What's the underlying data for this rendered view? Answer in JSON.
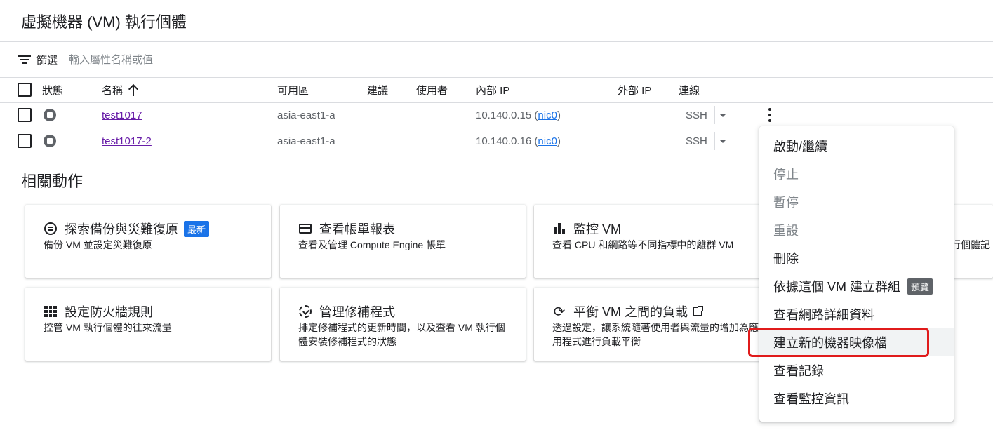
{
  "page": {
    "title": "虛擬機器 (VM) 執行個體"
  },
  "filter": {
    "label": "篩選",
    "placeholder": "輸入屬性名稱或值"
  },
  "table": {
    "headers": {
      "status": "狀態",
      "name": "名稱",
      "zone": "可用區",
      "recommendation": "建議",
      "in_use_by": "使用者",
      "internal_ip": "內部 IP",
      "external_ip": "外部 IP",
      "connect": "連線"
    },
    "rows": [
      {
        "name": "test1017",
        "zone": "asia-east1-a",
        "internal_ip": "10.140.0.15 (",
        "nic": "nic0",
        "nic_close": ")",
        "connect": "SSH",
        "status": "stopped"
      },
      {
        "name": "test1017-2",
        "zone": "asia-east1-a",
        "internal_ip": "10.140.0.16 (",
        "nic": "nic0",
        "nic_close": ")",
        "connect": "SSH",
        "status": "stopped"
      }
    ]
  },
  "related": {
    "title": "相關動作",
    "cards": [
      {
        "icon": "backup-icon",
        "title": "探索備份與災難復原",
        "badge": "最新",
        "desc": "備份 VM 並設定災難復原"
      },
      {
        "icon": "billing-icon",
        "title": "查看帳單報表",
        "desc": "查看及管理 Compute Engine 帳單"
      },
      {
        "icon": "bar-chart-icon",
        "title": "監控 VM",
        "desc": "查看 CPU 和網路等不同指標中的離群 VM"
      },
      {
        "icon": "hidden-card",
        "title": "",
        "desc": "行個體記"
      },
      {
        "icon": "firewall-icon",
        "title": "設定防火牆規則",
        "desc": "控管 VM 執行個體的往來流量"
      },
      {
        "icon": "patch-icon",
        "title": "管理修補程式",
        "desc": "排定修補程式的更新時間，以及查看 VM 執行個體安裝修補程式的狀態"
      },
      {
        "icon": "load-balance-icon",
        "title": "平衡 VM 之間的負載",
        "desc": "透過設定，讓系統隨著使用者與流量的增加為應用程式進行負載平衡"
      }
    ]
  },
  "menu": {
    "items": [
      {
        "label": "啟動/繼續",
        "enabled": true
      },
      {
        "label": "停止",
        "enabled": false
      },
      {
        "label": "暫停",
        "enabled": false
      },
      {
        "label": "重設",
        "enabled": false
      },
      {
        "label": "刪除",
        "enabled": true
      },
      {
        "label": "依據這個 VM 建立群組",
        "badge": "預覽",
        "enabled": true
      },
      {
        "label": "查看網路詳細資料",
        "enabled": true
      },
      {
        "label": "建立新的機器映像檔",
        "enabled": true,
        "highlighted": true
      },
      {
        "label": "查看記錄",
        "enabled": true
      },
      {
        "label": "查看監控資訊",
        "enabled": true
      }
    ]
  },
  "colors": {
    "link_visited": "#681da8",
    "link": "#1a73e8",
    "badge_new": "#1a73e8",
    "badge_preview": "#5f6368",
    "highlight_outline": "#e01b1b"
  }
}
